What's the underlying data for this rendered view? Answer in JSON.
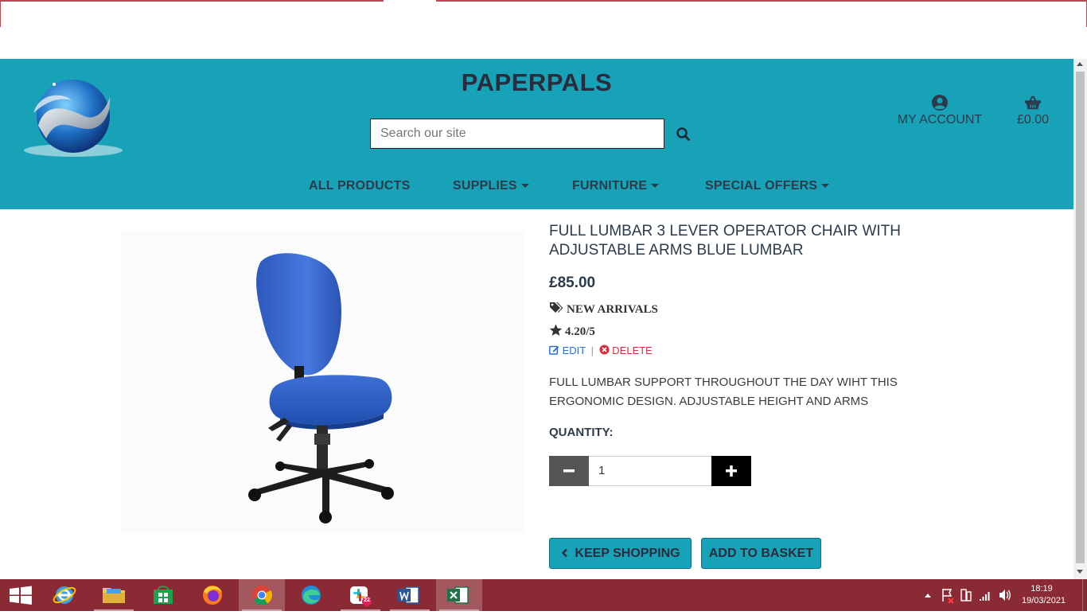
{
  "site": {
    "brand": "PAPERPALS",
    "search": {
      "placeholder": "Search our site"
    },
    "account": {
      "label": "MY ACCOUNT"
    },
    "basket": {
      "label": "£0.00"
    },
    "nav": [
      {
        "label": "ALL PRODUCTS",
        "has_caret": false
      },
      {
        "label": "SUPPLIES",
        "has_caret": true
      },
      {
        "label": "FURNITURE",
        "has_caret": true
      },
      {
        "label": "SPECIAL OFFERS",
        "has_caret": true
      }
    ],
    "accent_color": "#17a2b8"
  },
  "product": {
    "title": "FULL LUMBAR 3 LEVER OPERATOR CHAIR WITH ADJUSTABLE ARMS BLUE LUMBAR",
    "price": "£85.00",
    "category": "NEW ARRIVALS",
    "rating": "4.20/5",
    "edit_label": "EDIT",
    "separator": "|",
    "delete_label": "DELETE",
    "description": "FULL LUMBAR SUPPORT THROUGHOUT THE DAY WIHT THIS ERGONOMIC DESIGN. ADJUSTABLE HEIGHT AND ARMS",
    "quantity_label": "QUANTITY:",
    "quantity_value": "1",
    "keep_shopping_label": "KEEP SHOPPING",
    "add_to_basket_label": "ADD TO BASKET"
  },
  "taskbar": {
    "apps": [
      "start-icon",
      "internet-explorer-icon",
      "file-explorer-icon",
      "store-icon",
      "firefox-icon",
      "chrome-icon",
      "edge-icon",
      "slack-icon",
      "word-icon",
      "excel-icon"
    ],
    "slack_badge": "22",
    "time": "18:19",
    "date": "19/03/2021"
  }
}
